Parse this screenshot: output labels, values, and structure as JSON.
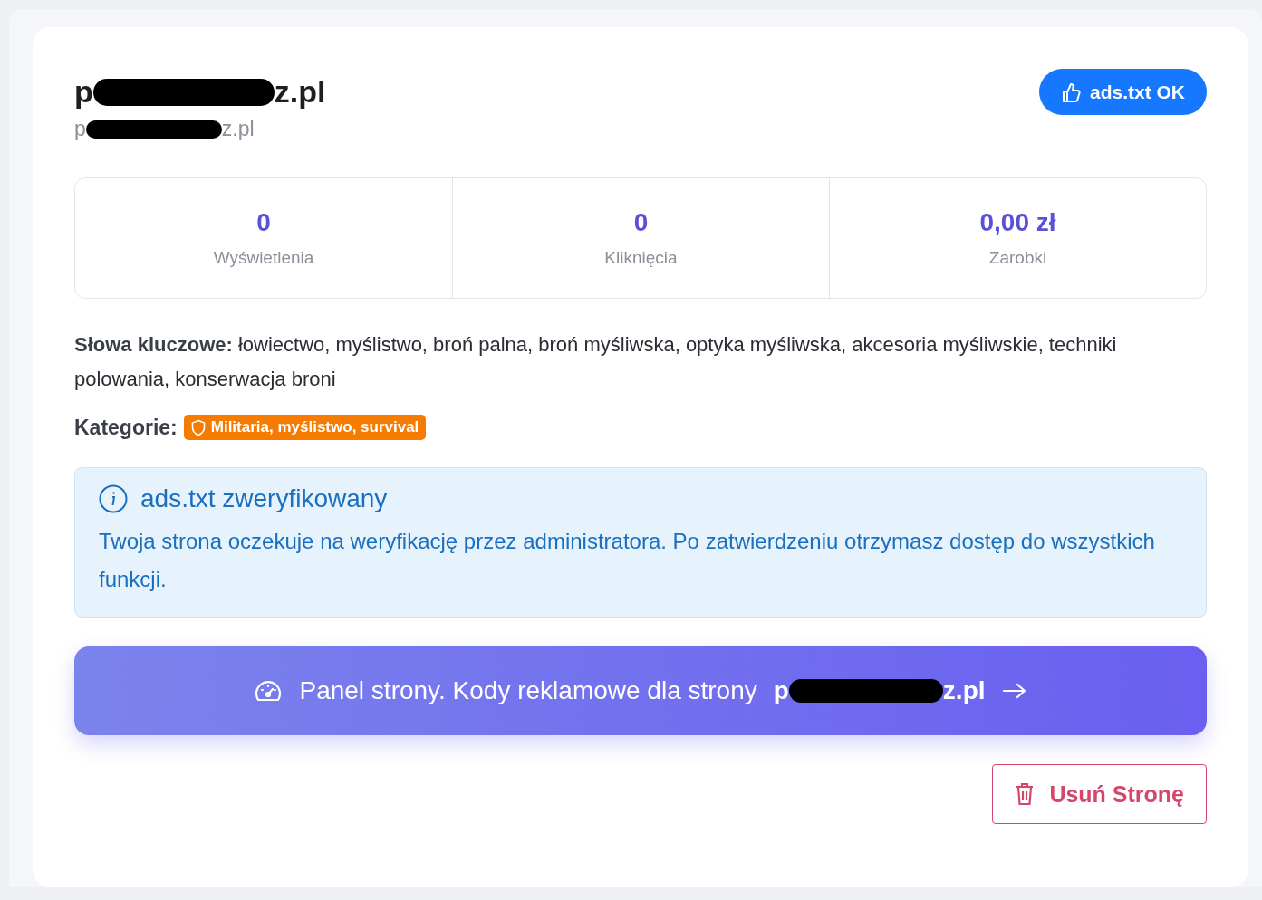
{
  "site": {
    "title": {
      "start": "p",
      "end": "z.pl"
    },
    "subtitle": {
      "start": "p",
      "end": "z.pl"
    }
  },
  "status_badge": {
    "label": "ads.txt OK"
  },
  "stats": [
    {
      "value": "0",
      "label": "Wyświetlenia"
    },
    {
      "value": "0",
      "label": "Kliknięcia"
    },
    {
      "value": "0,00 zł",
      "label": "Zarobki"
    }
  ],
  "keywords": "**Słowa kluczowe:** łowiectwo, myślistwo, broń palna, broń myśliwska, optyka myśliwska, akcesoria myśliwskie, techniki polowania, konserwacja broni",
  "categories": {
    "label": "Kategorie:",
    "items": [
      {
        "label": "Militaria, myślistwo, survival",
        "color": "#f57c00"
      }
    ]
  },
  "notice": {
    "title": "ads.txt zweryfikowany",
    "text": "Twoja strona oczekuje na weryfikację przez administratora. Po zatwierdzeniu otrzymasz dostęp do wszystkich funkcji."
  },
  "panel_button": {
    "label": "Panel strony. Kody reklamowe dla strony",
    "site": {
      "start": "p",
      "end": "z.pl"
    }
  },
  "delete_button": {
    "label": "Usuń Stronę"
  }
}
